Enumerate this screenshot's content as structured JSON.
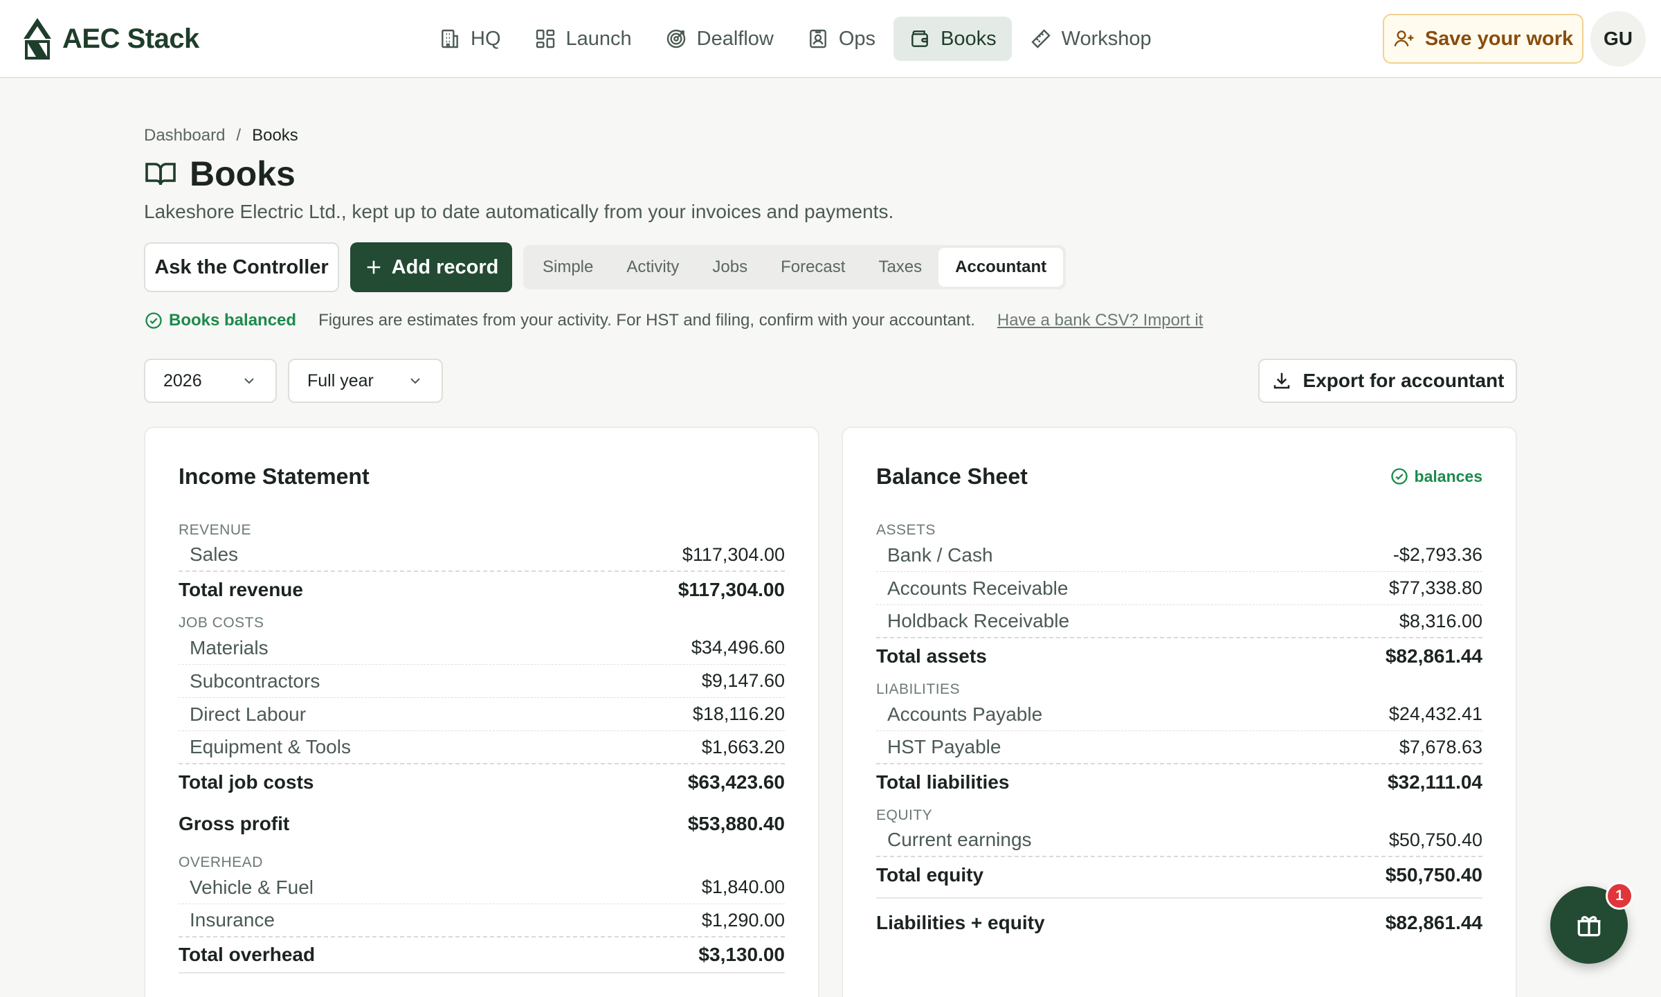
{
  "app": {
    "name": "AEC Stack",
    "avatar_initials": "GU",
    "save_label": "Save your work"
  },
  "nav": [
    {
      "label": "HQ",
      "icon": "building-icon"
    },
    {
      "label": "Launch",
      "icon": "grid-icon"
    },
    {
      "label": "Dealflow",
      "icon": "target-icon"
    },
    {
      "label": "Ops",
      "icon": "badge-icon"
    },
    {
      "label": "Books",
      "icon": "wallet-icon",
      "active": true
    },
    {
      "label": "Workshop",
      "icon": "ruler-icon"
    }
  ],
  "breadcrumb": {
    "parent": "Dashboard",
    "separator": "/",
    "current": "Books"
  },
  "page": {
    "title": "Books",
    "subtitle": "Lakeshore Electric Ltd., kept up to date automatically from your invoices and payments."
  },
  "actions": {
    "ask": "Ask the Controller",
    "add": "Add record",
    "export": "Export for accountant"
  },
  "tabs": [
    "Simple",
    "Activity",
    "Jobs",
    "Forecast",
    "Taxes",
    "Accountant"
  ],
  "active_tab": "Accountant",
  "status": {
    "balanced": "Books balanced",
    "note": "Figures are estimates from your activity. For HST and filing, confirm with your accountant.",
    "import_link": "Have a bank CSV? Import it"
  },
  "filters": {
    "year": "2026",
    "period": "Full year"
  },
  "income": {
    "title": "Income Statement",
    "revenue_label": "REVENUE",
    "revenue": [
      {
        "label": "Sales",
        "value": "$117,304.00"
      }
    ],
    "total_revenue": {
      "label": "Total revenue",
      "value": "$117,304.00"
    },
    "jobcosts_label": "JOB COSTS",
    "jobcosts": [
      {
        "label": "Materials",
        "value": "$34,496.60"
      },
      {
        "label": "Subcontractors",
        "value": "$9,147.60"
      },
      {
        "label": "Direct Labour",
        "value": "$18,116.20"
      },
      {
        "label": "Equipment & Tools",
        "value": "$1,663.20"
      }
    ],
    "total_jobcosts": {
      "label": "Total job costs",
      "value": "$63,423.60"
    },
    "gross_profit": {
      "label": "Gross profit",
      "value": "$53,880.40"
    },
    "overhead_label": "OVERHEAD",
    "overhead": [
      {
        "label": "Vehicle & Fuel",
        "value": "$1,840.00"
      },
      {
        "label": "Insurance",
        "value": "$1,290.00"
      }
    ],
    "total_overhead": {
      "label": "Total overhead",
      "value": "$3,130.00"
    }
  },
  "balance": {
    "title": "Balance Sheet",
    "badge": "balances",
    "assets_label": "ASSETS",
    "assets": [
      {
        "label": "Bank / Cash",
        "value": "-$2,793.36"
      },
      {
        "label": "Accounts Receivable",
        "value": "$77,338.80"
      },
      {
        "label": "Holdback Receivable",
        "value": "$8,316.00"
      }
    ],
    "total_assets": {
      "label": "Total assets",
      "value": "$82,861.44"
    },
    "liabilities_label": "LIABILITIES",
    "liabilities": [
      {
        "label": "Accounts Payable",
        "value": "$24,432.41"
      },
      {
        "label": "HST Payable",
        "value": "$7,678.63"
      }
    ],
    "total_liabilities": {
      "label": "Total liabilities",
      "value": "$32,111.04"
    },
    "equity_label": "EQUITY",
    "equity": [
      {
        "label": "Current earnings",
        "value": "$50,750.40"
      }
    ],
    "total_equity": {
      "label": "Total equity",
      "value": "$50,750.40"
    },
    "liab_equity": {
      "label": "Liabilities + equity",
      "value": "$82,861.44"
    }
  },
  "fab": {
    "badge": "1",
    "icon": "gift-icon"
  },
  "colors": {
    "brand": "#234a33",
    "accent_text": "#1f3d2b",
    "success": "#1c8a4c",
    "warning_bg": "#fffbef",
    "badge": "#e0353a"
  }
}
